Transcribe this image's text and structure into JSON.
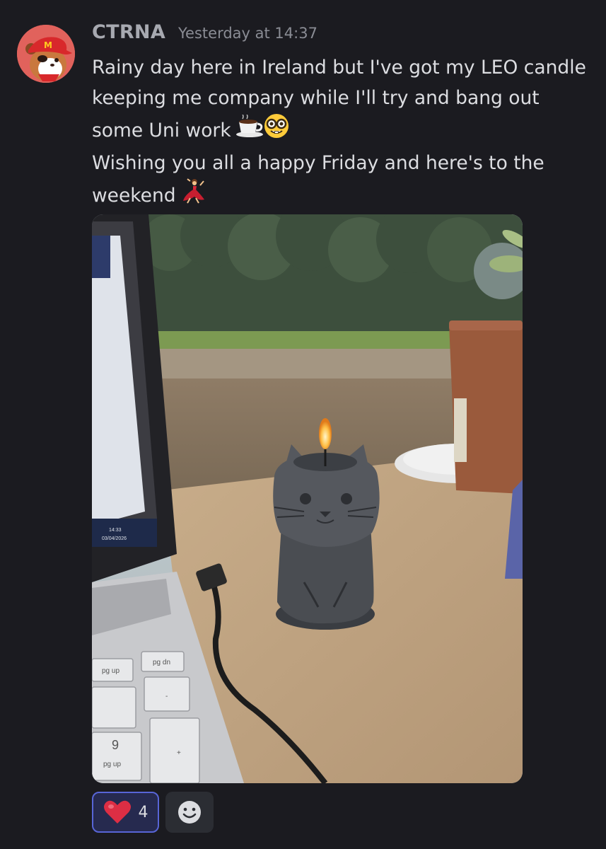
{
  "message": {
    "author": "CTRNA",
    "timestamp": "Yesterday at 14:37",
    "lines": [
      "Rainy day here in Ireland but I've got my LEO candle",
      "keeping me company while I'll try and bang out",
      "some Uni work",
      "Wishing you all a happy Friday and here's to the",
      "weekend"
    ],
    "emojis": {
      "line3": [
        "coffee-emoji",
        "nerd-face-emoji"
      ],
      "line5": [
        "dancer-emoji"
      ]
    }
  },
  "attachment": {
    "laptop_clock_time": "14:33",
    "laptop_clock_date": "03/04/2026",
    "key_labels": [
      "pg up",
      "pg dn",
      "9",
      "pg up",
      "-",
      "+"
    ]
  },
  "reactions": [
    {
      "icon": "heart-emoji",
      "count": "4",
      "active": true
    }
  ],
  "add_reaction_icon": "smiley-add-reaction-icon",
  "colors": {
    "background": "#1b1b20",
    "reaction_active_border": "#5865d6",
    "reaction_active_bg": "#262a4f",
    "heart": "#dd2e44"
  }
}
